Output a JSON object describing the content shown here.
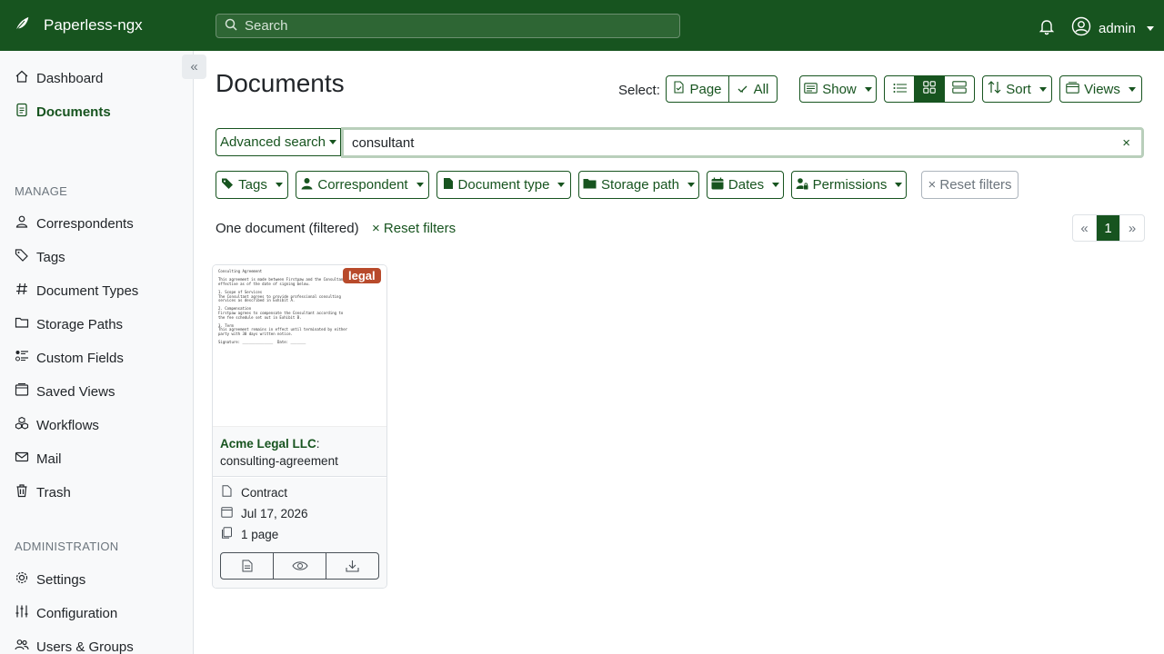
{
  "app": {
    "title": "Paperless-ngx"
  },
  "search": {
    "placeholder": "Search"
  },
  "user": {
    "name": "admin"
  },
  "sidebar": {
    "items": [
      {
        "label": "Dashboard",
        "icon": "house-icon"
      },
      {
        "label": "Documents",
        "icon": "file-text-icon",
        "active": true
      }
    ],
    "manage_label": "MANAGE",
    "manage": [
      {
        "label": "Correspondents",
        "icon": "person-icon"
      },
      {
        "label": "Tags",
        "icon": "tags-icon"
      },
      {
        "label": "Document Types",
        "icon": "hash-icon"
      },
      {
        "label": "Storage Paths",
        "icon": "folder-icon"
      },
      {
        "label": "Custom Fields",
        "icon": "ui-radios-icon"
      },
      {
        "label": "Saved Views",
        "icon": "saved-views-icon"
      },
      {
        "label": "Workflows",
        "icon": "boxes-icon"
      },
      {
        "label": "Mail",
        "icon": "envelope-icon"
      },
      {
        "label": "Trash",
        "icon": "trash-icon"
      }
    ],
    "admin_label": "ADMINISTRATION",
    "admin": [
      {
        "label": "Settings",
        "icon": "gear-icon"
      },
      {
        "label": "Configuration",
        "icon": "sliders-icon"
      },
      {
        "label": "Users & Groups",
        "icon": "people-icon"
      }
    ]
  },
  "main": {
    "title": "Documents",
    "select_label": "Select:",
    "select_page": "Page",
    "select_all": "All",
    "show": "Show",
    "sort": "Sort",
    "views": "Views",
    "advanced_search": "Advanced search",
    "query": "consultant",
    "clear": "×",
    "filters": {
      "tags": "Tags",
      "correspondent": "Correspondent",
      "document_type": "Document type",
      "storage_path": "Storage path",
      "dates": "Dates",
      "permissions": "Permissions",
      "reset": "× Reset filters"
    },
    "result_count": "One document (filtered)",
    "reset_link": "× Reset filters",
    "pager": {
      "prev": "«",
      "current": "1",
      "next": "»"
    }
  },
  "document": {
    "tag": "legal",
    "tag_color": "#b84a2b",
    "correspondent": "Acme Legal LLC",
    "title": ": consulting-agreement",
    "type": "Contract",
    "date": "Jul 17, 2026",
    "pages": "1 page",
    "thumbnail_text": "Consulting Agreement\n\nThis agreement is made between Firstpaw and the Consultant,\neffective as of the date of signing below.\n\n1. Scope of Services\nThe Consultant agrees to provide professional consulting\nservices as described in Exhibit A.\n\n2. Compensation\nFirstpaw agrees to compensate the Consultant according to\nthe fee schedule set out in Exhibit B.\n\n3. Term\nThis agreement remains in effect until terminated by either\nparty with 30 days written notice.\n\nSignature: ______________  Date: _______"
  },
  "colors": {
    "primary": "#17541f",
    "sidebar_bg": "#f8f9fa"
  }
}
